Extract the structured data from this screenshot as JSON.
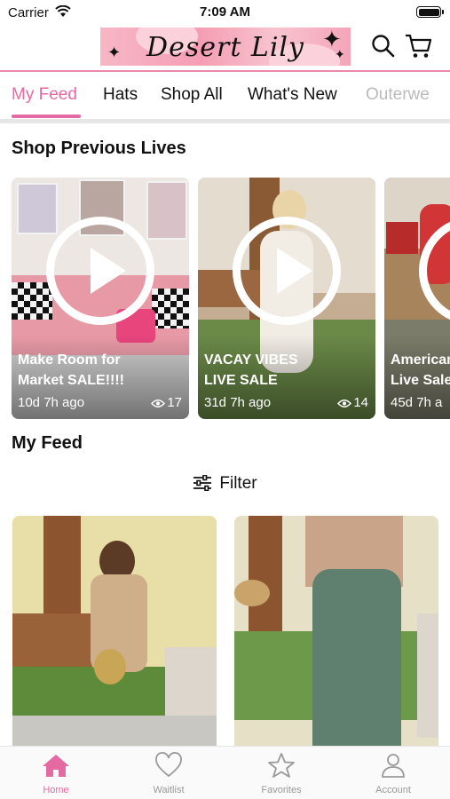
{
  "status_bar": {
    "carrier": "Carrier",
    "time": "7:09 AM"
  },
  "header": {
    "logo_text": "Desert Lily",
    "icons": [
      "search-icon",
      "cart-icon"
    ]
  },
  "tabs": [
    {
      "label": "My Feed",
      "active": true
    },
    {
      "label": "Hats"
    },
    {
      "label": "Shop All"
    },
    {
      "label": "What's New"
    },
    {
      "label": "Outerwe"
    }
  ],
  "sections": {
    "lives_title": "Shop Previous Lives",
    "feed_title": "My Feed"
  },
  "lives": [
    {
      "title": "Make Room for\nMarket SALE!!!!",
      "age": "10d 7h ago",
      "views": "17"
    },
    {
      "title": "VACAY VIBES\nLIVE SALE",
      "age": "31d 7h ago",
      "views": "14"
    },
    {
      "title": "American\nLive Sale",
      "age": "45d 7h a",
      "views": ""
    }
  ],
  "filter": {
    "label": "Filter"
  },
  "tab_bar": [
    {
      "label": "Home",
      "icon": "home-icon",
      "active": true
    },
    {
      "label": "Waitlist",
      "icon": "heart-icon"
    },
    {
      "label": "Favorites",
      "icon": "star-icon"
    },
    {
      "label": "Account",
      "icon": "person-icon"
    }
  ],
  "colors": {
    "accent": "#e46aa1",
    "header_line": "#e98aab",
    "logo_bg": "#f59eb3"
  }
}
